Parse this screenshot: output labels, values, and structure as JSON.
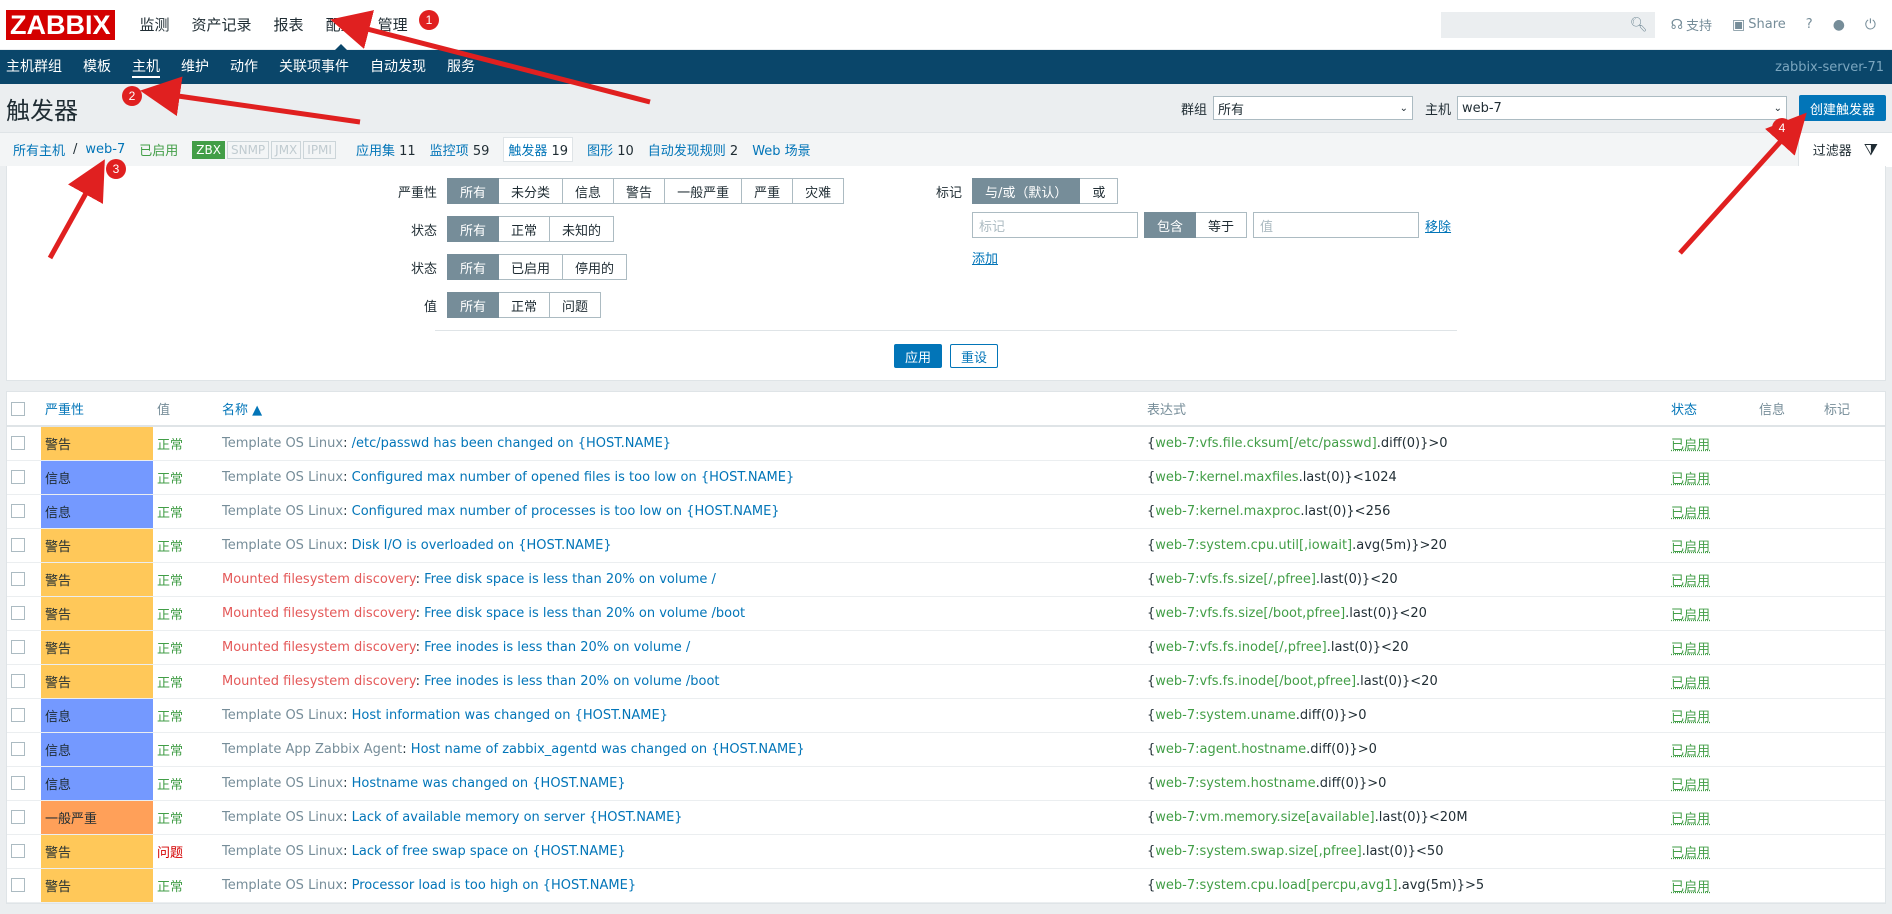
{
  "topbar": {
    "logo": "ZABBIX",
    "menu": [
      "监测",
      "资产记录",
      "报表",
      "配置",
      "管理"
    ],
    "support": "支持",
    "share": "Share",
    "help": "?",
    "icons": [
      "search-icon",
      "headset-icon",
      "share-icon",
      "help-icon",
      "user-icon",
      "power-icon"
    ]
  },
  "navbar": {
    "items": [
      "主机群组",
      "模板",
      "主机",
      "维护",
      "动作",
      "关联项事件",
      "自动发现",
      "服务"
    ],
    "server": "zabbix-server-71"
  },
  "header": {
    "title": "触发器",
    "group_label": "群组",
    "group_value": "所有",
    "host_label": "主机",
    "host_value": "web-7",
    "create_button": "创建触发器"
  },
  "hostnav": {
    "all_hosts": "所有主机",
    "sep": "/",
    "host": "web-7",
    "enabled": "已启用",
    "avail": [
      "ZBX",
      "SNMP",
      "JMX",
      "IPMI"
    ],
    "apps_label": "应用集",
    "apps_count": "11",
    "items_label": "监控项",
    "items_count": "59",
    "triggers_label": "触发器",
    "triggers_count": "19",
    "graphs_label": "图形",
    "graphs_count": "10",
    "discovery_label": "自动发现规则",
    "discovery_count": "2",
    "web_label": "Web 场景",
    "filter_label": "过滤器"
  },
  "filter": {
    "severity_label": "严重性",
    "severity_options": [
      "所有",
      "未分类",
      "信息",
      "警告",
      "一般严重",
      "严重",
      "灾难"
    ],
    "state_label": "状态",
    "state_options": [
      "所有",
      "正常",
      "未知的"
    ],
    "status_label": "状态",
    "status_options": [
      "所有",
      "已启用",
      "停用的"
    ],
    "value_label": "值",
    "value_options": [
      "所有",
      "正常",
      "问题"
    ],
    "tags_label": "标记",
    "tags_mode": [
      "与/或（默认）",
      "或"
    ],
    "tag_placeholder": "标记",
    "tag_op": [
      "包含",
      "等于"
    ],
    "value_placeholder": "值",
    "remove": "移除",
    "add": "添加",
    "apply": "应用",
    "reset": "重设"
  },
  "table": {
    "headers": [
      "严重性",
      "值",
      "名称 ▲",
      "表达式",
      "状态",
      "信息",
      "标记"
    ],
    "rows": [
      {
        "sev": "警告",
        "sevcolor": "#ffc859",
        "val": "正常",
        "prefix": "Template OS Linux",
        "ptype": "tmpl",
        "name": "/etc/passwd has been changed on {HOST.NAME}",
        "ex1": "{",
        "exhost": "web-7:vfs.file.cksum[/etc/passwd]",
        "exfn": ".diff(0)}>0",
        "status": "已启用"
      },
      {
        "sev": "信息",
        "sevcolor": "#7499ff",
        "val": "正常",
        "prefix": "Template OS Linux",
        "ptype": "tmpl",
        "name": "Configured max number of opened files is too low on {HOST.NAME}",
        "ex1": "{",
        "exhost": "web-7:kernel.maxfiles",
        "exfn": ".last(0)}<1024",
        "status": "已启用"
      },
      {
        "sev": "信息",
        "sevcolor": "#7499ff",
        "val": "正常",
        "prefix": "Template OS Linux",
        "ptype": "tmpl",
        "name": "Configured max number of processes is too low on {HOST.NAME}",
        "ex1": "{",
        "exhost": "web-7:kernel.maxproc",
        "exfn": ".last(0)}<256",
        "status": "已启用"
      },
      {
        "sev": "警告",
        "sevcolor": "#ffc859",
        "val": "正常",
        "prefix": "Template OS Linux",
        "ptype": "tmpl",
        "name": "Disk I/O is overloaded on {HOST.NAME}",
        "ex1": "{",
        "exhost": "web-7:system.cpu.util[,iowait]",
        "exfn": ".avg(5m)}>20",
        "status": "已启用"
      },
      {
        "sev": "警告",
        "sevcolor": "#ffc859",
        "val": "正常",
        "prefix": "Mounted filesystem discovery",
        "ptype": "disc",
        "name": "Free disk space is less than 20% on volume /",
        "ex1": "{",
        "exhost": "web-7:vfs.fs.size[/,pfree]",
        "exfn": ".last(0)}<20",
        "status": "已启用"
      },
      {
        "sev": "警告",
        "sevcolor": "#ffc859",
        "val": "正常",
        "prefix": "Mounted filesystem discovery",
        "ptype": "disc",
        "name": "Free disk space is less than 20% on volume /boot",
        "ex1": "{",
        "exhost": "web-7:vfs.fs.size[/boot,pfree]",
        "exfn": ".last(0)}<20",
        "status": "已启用"
      },
      {
        "sev": "警告",
        "sevcolor": "#ffc859",
        "val": "正常",
        "prefix": "Mounted filesystem discovery",
        "ptype": "disc",
        "name": "Free inodes is less than 20% on volume /",
        "ex1": "{",
        "exhost": "web-7:vfs.fs.inode[/,pfree]",
        "exfn": ".last(0)}<20",
        "status": "已启用"
      },
      {
        "sev": "警告",
        "sevcolor": "#ffc859",
        "val": "正常",
        "prefix": "Mounted filesystem discovery",
        "ptype": "disc",
        "name": "Free inodes is less than 20% on volume /boot",
        "ex1": "{",
        "exhost": "web-7:vfs.fs.inode[/boot,pfree]",
        "exfn": ".last(0)}<20",
        "status": "已启用"
      },
      {
        "sev": "信息",
        "sevcolor": "#7499ff",
        "val": "正常",
        "prefix": "Template OS Linux",
        "ptype": "tmpl",
        "name": "Host information was changed on {HOST.NAME}",
        "ex1": "{",
        "exhost": "web-7:system.uname",
        "exfn": ".diff(0)}>0",
        "status": "已启用"
      },
      {
        "sev": "信息",
        "sevcolor": "#7499ff",
        "val": "正常",
        "prefix": "Template App Zabbix Agent",
        "ptype": "tmpl",
        "name": "Host name of zabbix_agentd was changed on {HOST.NAME}",
        "ex1": "{",
        "exhost": "web-7:agent.hostname",
        "exfn": ".diff(0)}>0",
        "status": "已启用"
      },
      {
        "sev": "信息",
        "sevcolor": "#7499ff",
        "val": "正常",
        "prefix": "Template OS Linux",
        "ptype": "tmpl",
        "name": "Hostname was changed on {HOST.NAME}",
        "ex1": "{",
        "exhost": "web-7:system.hostname",
        "exfn": ".diff(0)}>0",
        "status": "已启用"
      },
      {
        "sev": "一般严重",
        "sevcolor": "#ffa059",
        "val": "正常",
        "prefix": "Template OS Linux",
        "ptype": "tmpl",
        "name": "Lack of available memory on server {HOST.NAME}",
        "ex1": "{",
        "exhost": "web-7:vm.memory.size[available]",
        "exfn": ".last(0)}<20M",
        "status": "已启用"
      },
      {
        "sev": "警告",
        "sevcolor": "#ffc859",
        "val": "问题",
        "prefix": "Template OS Linux",
        "ptype": "tmpl",
        "name": "Lack of free swap space on {HOST.NAME}",
        "ex1": "{",
        "exhost": "web-7:system.swap.size[,pfree]",
        "exfn": ".last(0)}<50",
        "status": "已启用"
      },
      {
        "sev": "警告",
        "sevcolor": "#ffc859",
        "val": "正常",
        "prefix": "Template OS Linux",
        "ptype": "tmpl",
        "name": "Processor load is too high on {HOST.NAME}",
        "ex1": "{",
        "exhost": "web-7:system.cpu.load[percpu,avg1]",
        "exfn": ".avg(5m)}>5",
        "status": "已启用"
      }
    ]
  },
  "annotations": [
    "1",
    "2",
    "3",
    "4"
  ],
  "annotation_color": "#e02020"
}
